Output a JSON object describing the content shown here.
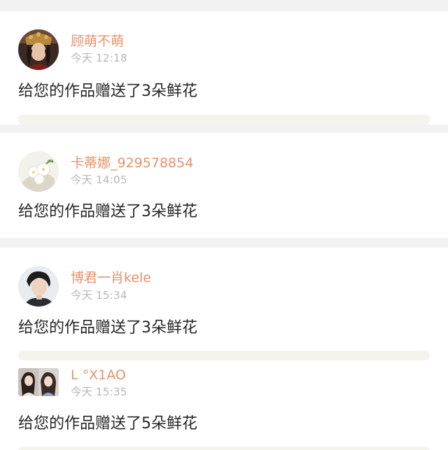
{
  "colors": {
    "username": "#e5926c",
    "timestamp": "#b8b8b8",
    "message": "#262626",
    "card_background": "#ffffff",
    "divider": "#f2f2f2",
    "strip": "#f4f3ec"
  },
  "notifications": [
    {
      "username": "顾萌不萌",
      "time": "今天 12:18",
      "message": "给您的作品赠送了3朵鲜花",
      "avatar_icon": "woman-in-headdress-avatar"
    },
    {
      "username": "卡蒂娜_929578854",
      "time": "今天 14:05",
      "message": "给您的作品赠送了3朵鲜花",
      "avatar_icon": "white-flowers-avatar"
    },
    {
      "username": "博君一肖kele",
      "time": "今天 15:34",
      "message": "给您的作品赠送了3朵鲜花",
      "avatar_icon": "young-man-avatar"
    },
    {
      "username": "L °X1AO",
      "time": "今天 15:35",
      "message": "给您的作品赠送了5朵鲜花",
      "avatar_icon": "two-girls-avatar"
    }
  ]
}
